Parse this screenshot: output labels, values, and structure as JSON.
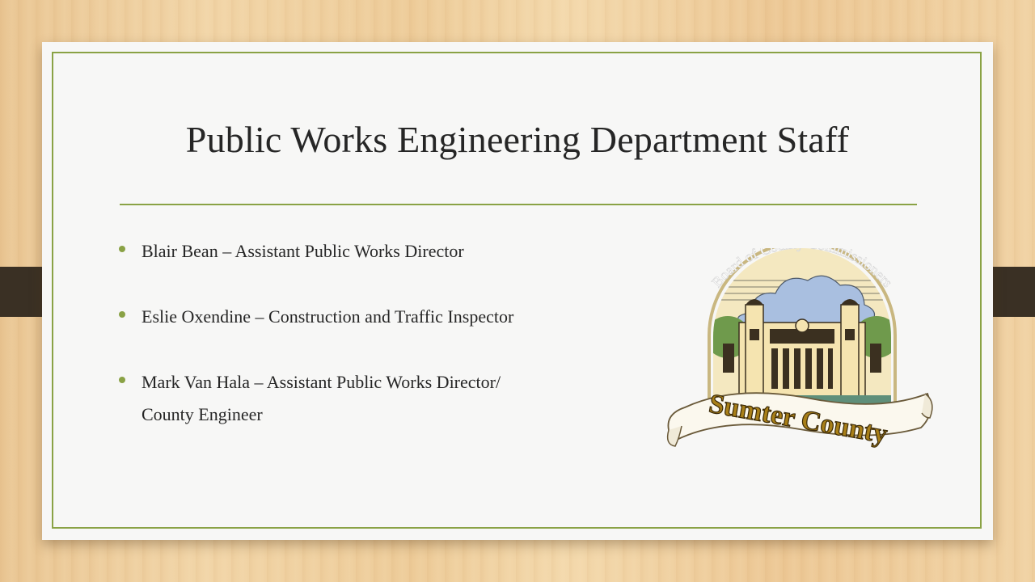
{
  "slide": {
    "title": "Public Works Engineering Department Staff",
    "bullets": [
      {
        "text": "Blair Bean – Assistant Public Works Director"
      },
      {
        "text": "Eslie Oxendine – Construction and Traffic Inspector"
      },
      {
        "text": "Mark Van Hala – Assistant Public Works Director/",
        "continuation": "County Engineer"
      }
    ],
    "logo": {
      "arc_text": "Board of County Commissioners",
      "banner_text": "Sumter County"
    }
  },
  "colors": {
    "accent": "#8aa245",
    "text": "#262626",
    "card": "#f7f7f6",
    "strap": "#3a3024"
  }
}
